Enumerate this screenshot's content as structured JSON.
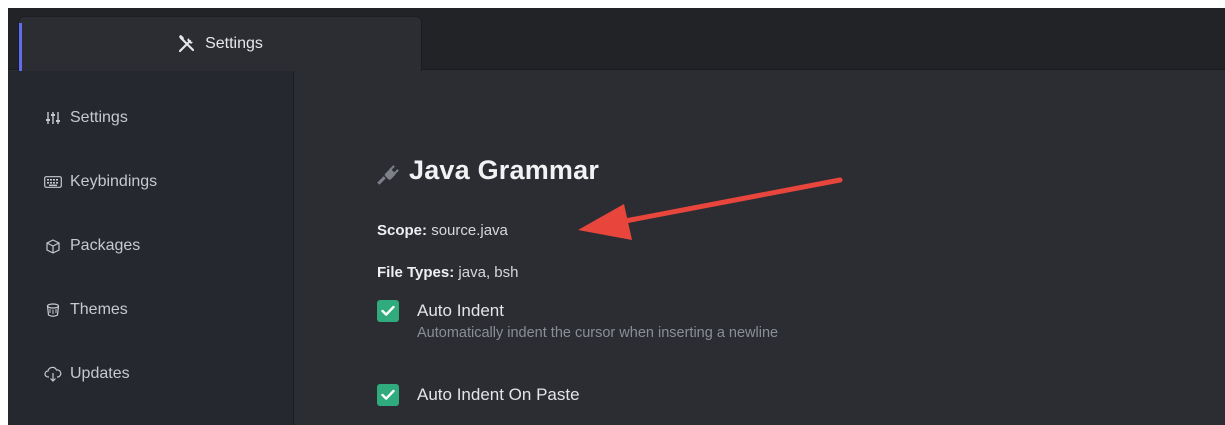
{
  "tab": {
    "label": "Settings",
    "icon": "tools-icon"
  },
  "sidebar": {
    "items": [
      {
        "label": "Settings",
        "icon": "sliders-icon"
      },
      {
        "label": "Keybindings",
        "icon": "keyboard-icon"
      },
      {
        "label": "Packages",
        "icon": "package-icon"
      },
      {
        "label": "Themes",
        "icon": "paint-bucket-icon"
      },
      {
        "label": "Updates",
        "icon": "cloud-download-icon"
      }
    ]
  },
  "package": {
    "title": "Java Grammar",
    "scope_label": "Scope:",
    "scope_value": "source.java",
    "filetypes_label": "File Types:",
    "filetypes_value": "java, bsh"
  },
  "options": [
    {
      "label": "Auto Indent",
      "description": "Automatically indent the cursor when inserting a newline",
      "checked": true
    },
    {
      "label": "Auto Indent On Paste",
      "description": "",
      "checked": true
    }
  ],
  "colors": {
    "accent": "#5e6cf2",
    "checkbox": "#2fab7d",
    "annotation_arrow": "#e8453c"
  }
}
